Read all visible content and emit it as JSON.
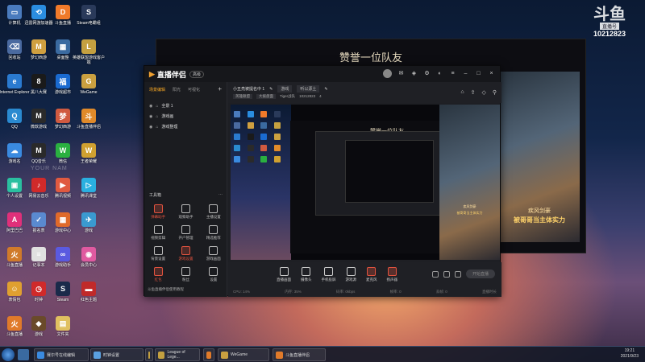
{
  "desktop": {
    "icons": [
      {
        "label": "计算机",
        "color": "#4a7bbd",
        "glyph": "▭"
      },
      {
        "label": "迅雷网游加速器",
        "color": "#2a8de0",
        "glyph": "⟲"
      },
      {
        "label": "斗鱼直播",
        "color": "#f07a2a",
        "glyph": "D"
      },
      {
        "label": "Steam电霸组",
        "color": "#2a3a5a",
        "glyph": "S"
      },
      {
        "label": "回收站",
        "color": "#4a6aa0",
        "glyph": "⌫"
      },
      {
        "label": "梦幻西游",
        "color": "#d0a040",
        "glyph": "M"
      },
      {
        "label": "桌面整",
        "color": "#3a6aa0",
        "glyph": "▦"
      },
      {
        "label": "英雄联盟游戏客户端",
        "color": "#c4a040",
        "glyph": "L"
      },
      {
        "label": "Internet Explorer",
        "color": "#2a7ad0",
        "glyph": "e"
      },
      {
        "label": "黑八大赛",
        "color": "#1a1a1a",
        "glyph": "8"
      },
      {
        "label": "游戏超市",
        "color": "#1a6ad0",
        "glyph": "福"
      },
      {
        "label": "WeGame",
        "color": "#caa040",
        "glyph": "G"
      },
      {
        "label": "QQ",
        "color": "#2a8ad0",
        "glyph": "Q"
      },
      {
        "label": "微软游戏",
        "color": "#2a2a2a",
        "glyph": "M"
      },
      {
        "label": "梦幻西游",
        "color": "#d05a40",
        "glyph": "梦"
      },
      {
        "label": "斗鱼直播伴侣",
        "color": "#e08a2a",
        "glyph": "斗"
      },
      {
        "label": "游戏名",
        "color": "#3a8ae0",
        "glyph": "☁"
      },
      {
        "label": "QQ音乐",
        "color": "#2a2a2a",
        "glyph": "M"
      },
      {
        "label": "微信",
        "color": "#2ab040",
        "glyph": "W"
      },
      {
        "label": "王者荣耀",
        "color": "#d0a030",
        "glyph": "W"
      },
      {
        "label": "个人设置",
        "color": "#2ac0a0",
        "glyph": "▣"
      },
      {
        "label": "网易云音乐",
        "color": "#d02a2a",
        "glyph": "♪"
      },
      {
        "label": "腾讯视频",
        "color": "#e05a40",
        "glyph": "▶"
      },
      {
        "label": "腾讯课堂",
        "color": "#2ab0e0",
        "glyph": "▷"
      },
      {
        "label": "阿里巴巴",
        "color": "#e0307a",
        "glyph": "A"
      },
      {
        "label": "报名表",
        "color": "#5a8ad0",
        "glyph": "✓"
      },
      {
        "label": "游戏中心",
        "color": "#e06a2a",
        "glyph": "▦"
      },
      {
        "label": "游戏",
        "color": "#3a9ad0",
        "glyph": "✈"
      },
      {
        "label": "斗鱼直播",
        "color": "#d07a2a",
        "glyph": "火"
      },
      {
        "label": "记事本",
        "color": "#e0e0e0",
        "glyph": "≡"
      },
      {
        "label": "游戏助手",
        "color": "#5a5ae0",
        "glyph": "∞"
      },
      {
        "label": "会员中心",
        "color": "#e05aa0",
        "glyph": "◉"
      },
      {
        "label": "表情包",
        "color": "#e0a030",
        "glyph": "☺"
      },
      {
        "label": "时钟",
        "color": "#d02a2a",
        "glyph": "◷"
      },
      {
        "label": "Steam",
        "color": "#1a2a4a",
        "glyph": "S"
      },
      {
        "label": "红色主题",
        "color": "#c02a2a",
        "glyph": "▬"
      },
      {
        "label": "斗鱼直播",
        "color": "#e07a2a",
        "glyph": "火"
      },
      {
        "label": "游戏",
        "color": "#6a4a2a",
        "glyph": "◆"
      },
      {
        "label": "文件夹",
        "color": "#e0c060",
        "glyph": "▤"
      }
    ],
    "watermark_faded": "YOUR NAM"
  },
  "douyu_watermark": {
    "logo": "斗鱼",
    "sub": "直播号",
    "room_id": "10212823"
  },
  "game_window": {
    "title": "赞誉一位队友",
    "caption1": "疾风剑豪",
    "caption2": "被哥哥当主体实力"
  },
  "app": {
    "brand": "直播伴侣",
    "version": "高级",
    "tabs": [
      "场景编辑",
      "阳光",
      "可视化"
    ],
    "scenes": [
      "全景 1",
      "游戏画",
      "游戏整理"
    ],
    "topbar": {
      "title": "小丑亮被提名中 1",
      "chip1": "游戏",
      "chip2": "听以源土",
      "meta1": "英雄联盟",
      "meta2": "大拨盘面",
      "meta3": "Tiger战队",
      "meta4": "10212823",
      "meta5": "4"
    },
    "tools_header": "工具箱",
    "tools": [
      {
        "label": "弹幕助手",
        "active": true
      },
      {
        "label": "观察助手",
        "active": false
      },
      {
        "label": "主播设置",
        "active": false
      },
      {
        "label": "视频剪辑",
        "active": false
      },
      {
        "label": "开户管理",
        "active": false
      },
      {
        "label": "精选推荐",
        "active": false
      },
      {
        "label": "背景设置",
        "active": false
      },
      {
        "label": "游戏设置",
        "active": true
      },
      {
        "label": "游戏画面",
        "active": false
      },
      {
        "label": "红包",
        "active": true
      },
      {
        "label": "粉丝",
        "active": false
      },
      {
        "label": "设置",
        "active": false
      }
    ],
    "cmd": "斗鱼直播伴侣使用教程",
    "preview_title": "赞誉一位队友",
    "preview_caption1": "疾风剑豪",
    "preview_caption2": "被哥哥当主体实力",
    "bottom": [
      {
        "label": "直播画面",
        "red": false
      },
      {
        "label": "摄像头",
        "red": false
      },
      {
        "label": "手机投屏",
        "red": false
      },
      {
        "label": "游戏源",
        "red": false
      },
      {
        "label": "麦克风",
        "red": true
      },
      {
        "label": "扬声器",
        "red": true
      }
    ],
    "live_button": "开始直播",
    "status": [
      "CPU: 14%",
      "内存: 35%",
      "码率: 0kbps",
      "帧率: 0",
      "丢帧: 0",
      "直播时长"
    ]
  },
  "taskbar": {
    "items": [
      {
        "label": "赛尔号在线编辑",
        "color": "#3a8ae0"
      },
      {
        "label": "时钟设置",
        "color": "#5aa0e0"
      },
      {
        "label": "",
        "color": "#c4a040"
      },
      {
        "label": "League of Lege...",
        "color": "#c4a040"
      },
      {
        "label": "",
        "color": "#e07a2a"
      },
      {
        "label": "WeGame",
        "color": "#caa040"
      },
      {
        "label": "斗鱼直播伴侣",
        "color": "#e07a2a"
      }
    ],
    "time": "19:21",
    "date": "2021/9/23"
  }
}
